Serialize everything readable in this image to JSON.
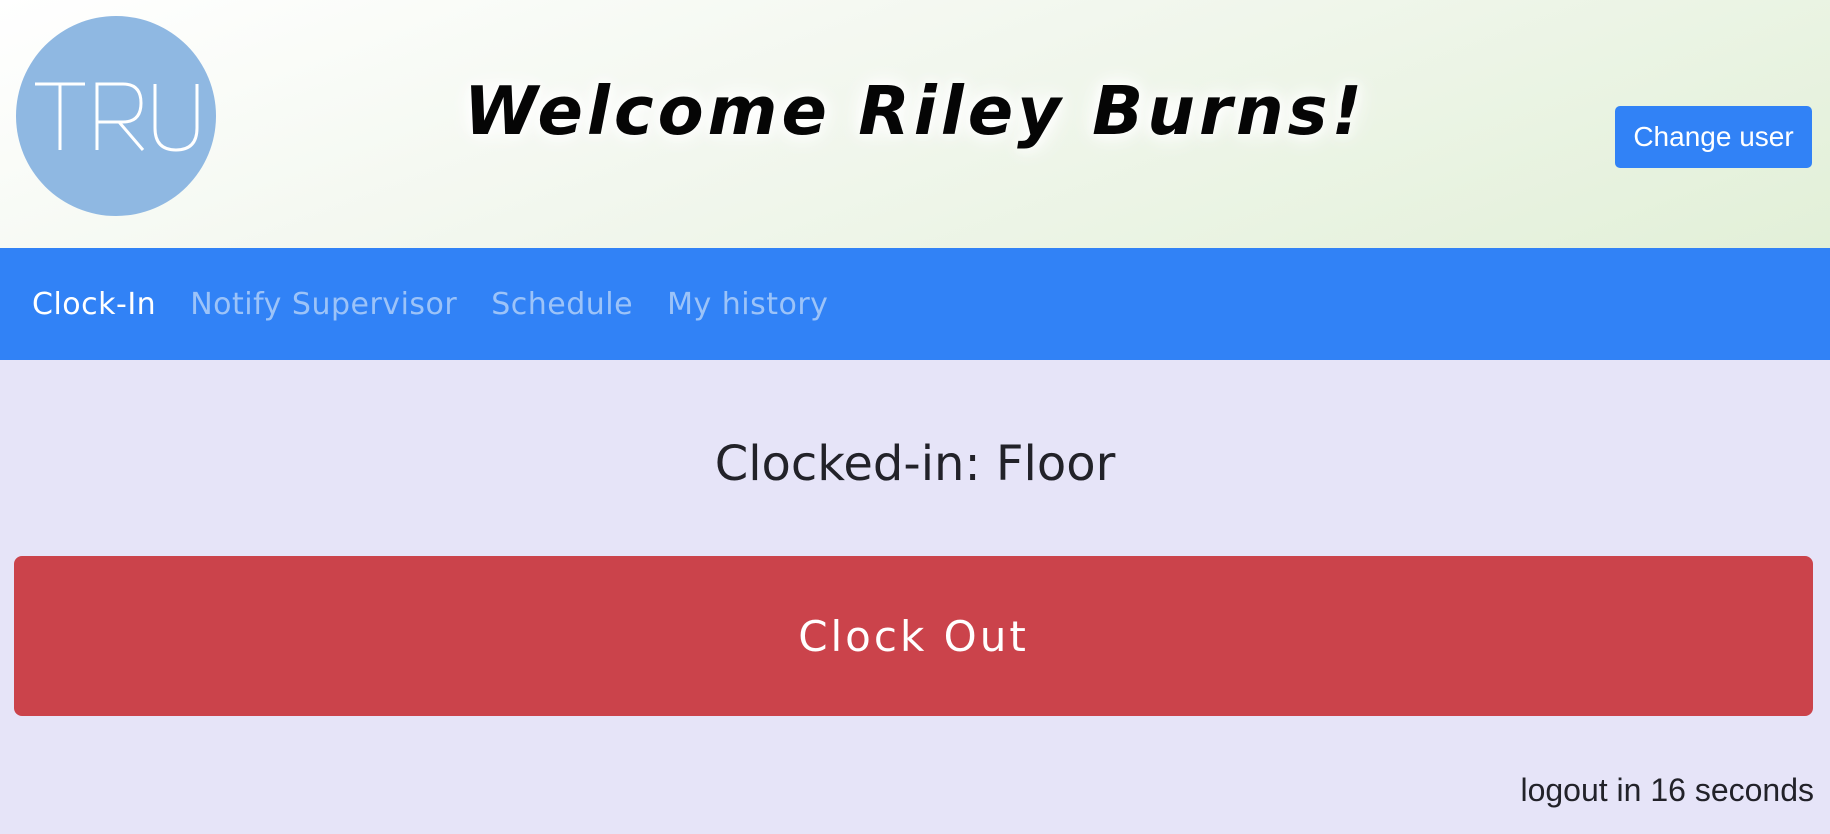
{
  "header": {
    "logo_text": "TRU",
    "welcome_text": "Welcome Riley Burns!",
    "change_user_label": "Change user"
  },
  "nav": {
    "items": [
      {
        "label": "Clock-In",
        "active": true
      },
      {
        "label": "Notify Supervisor",
        "active": false
      },
      {
        "label": "Schedule",
        "active": false
      },
      {
        "label": "My history",
        "active": false
      }
    ]
  },
  "main": {
    "status_text": "Clocked-in: Floor",
    "clock_out_label": "Clock Out",
    "logout_text": "logout in 16 seconds"
  },
  "colors": {
    "primary": "#3182f6",
    "danger": "#cb434b",
    "logo": "#8fb8e2",
    "page_background": "#e6e4f8"
  }
}
